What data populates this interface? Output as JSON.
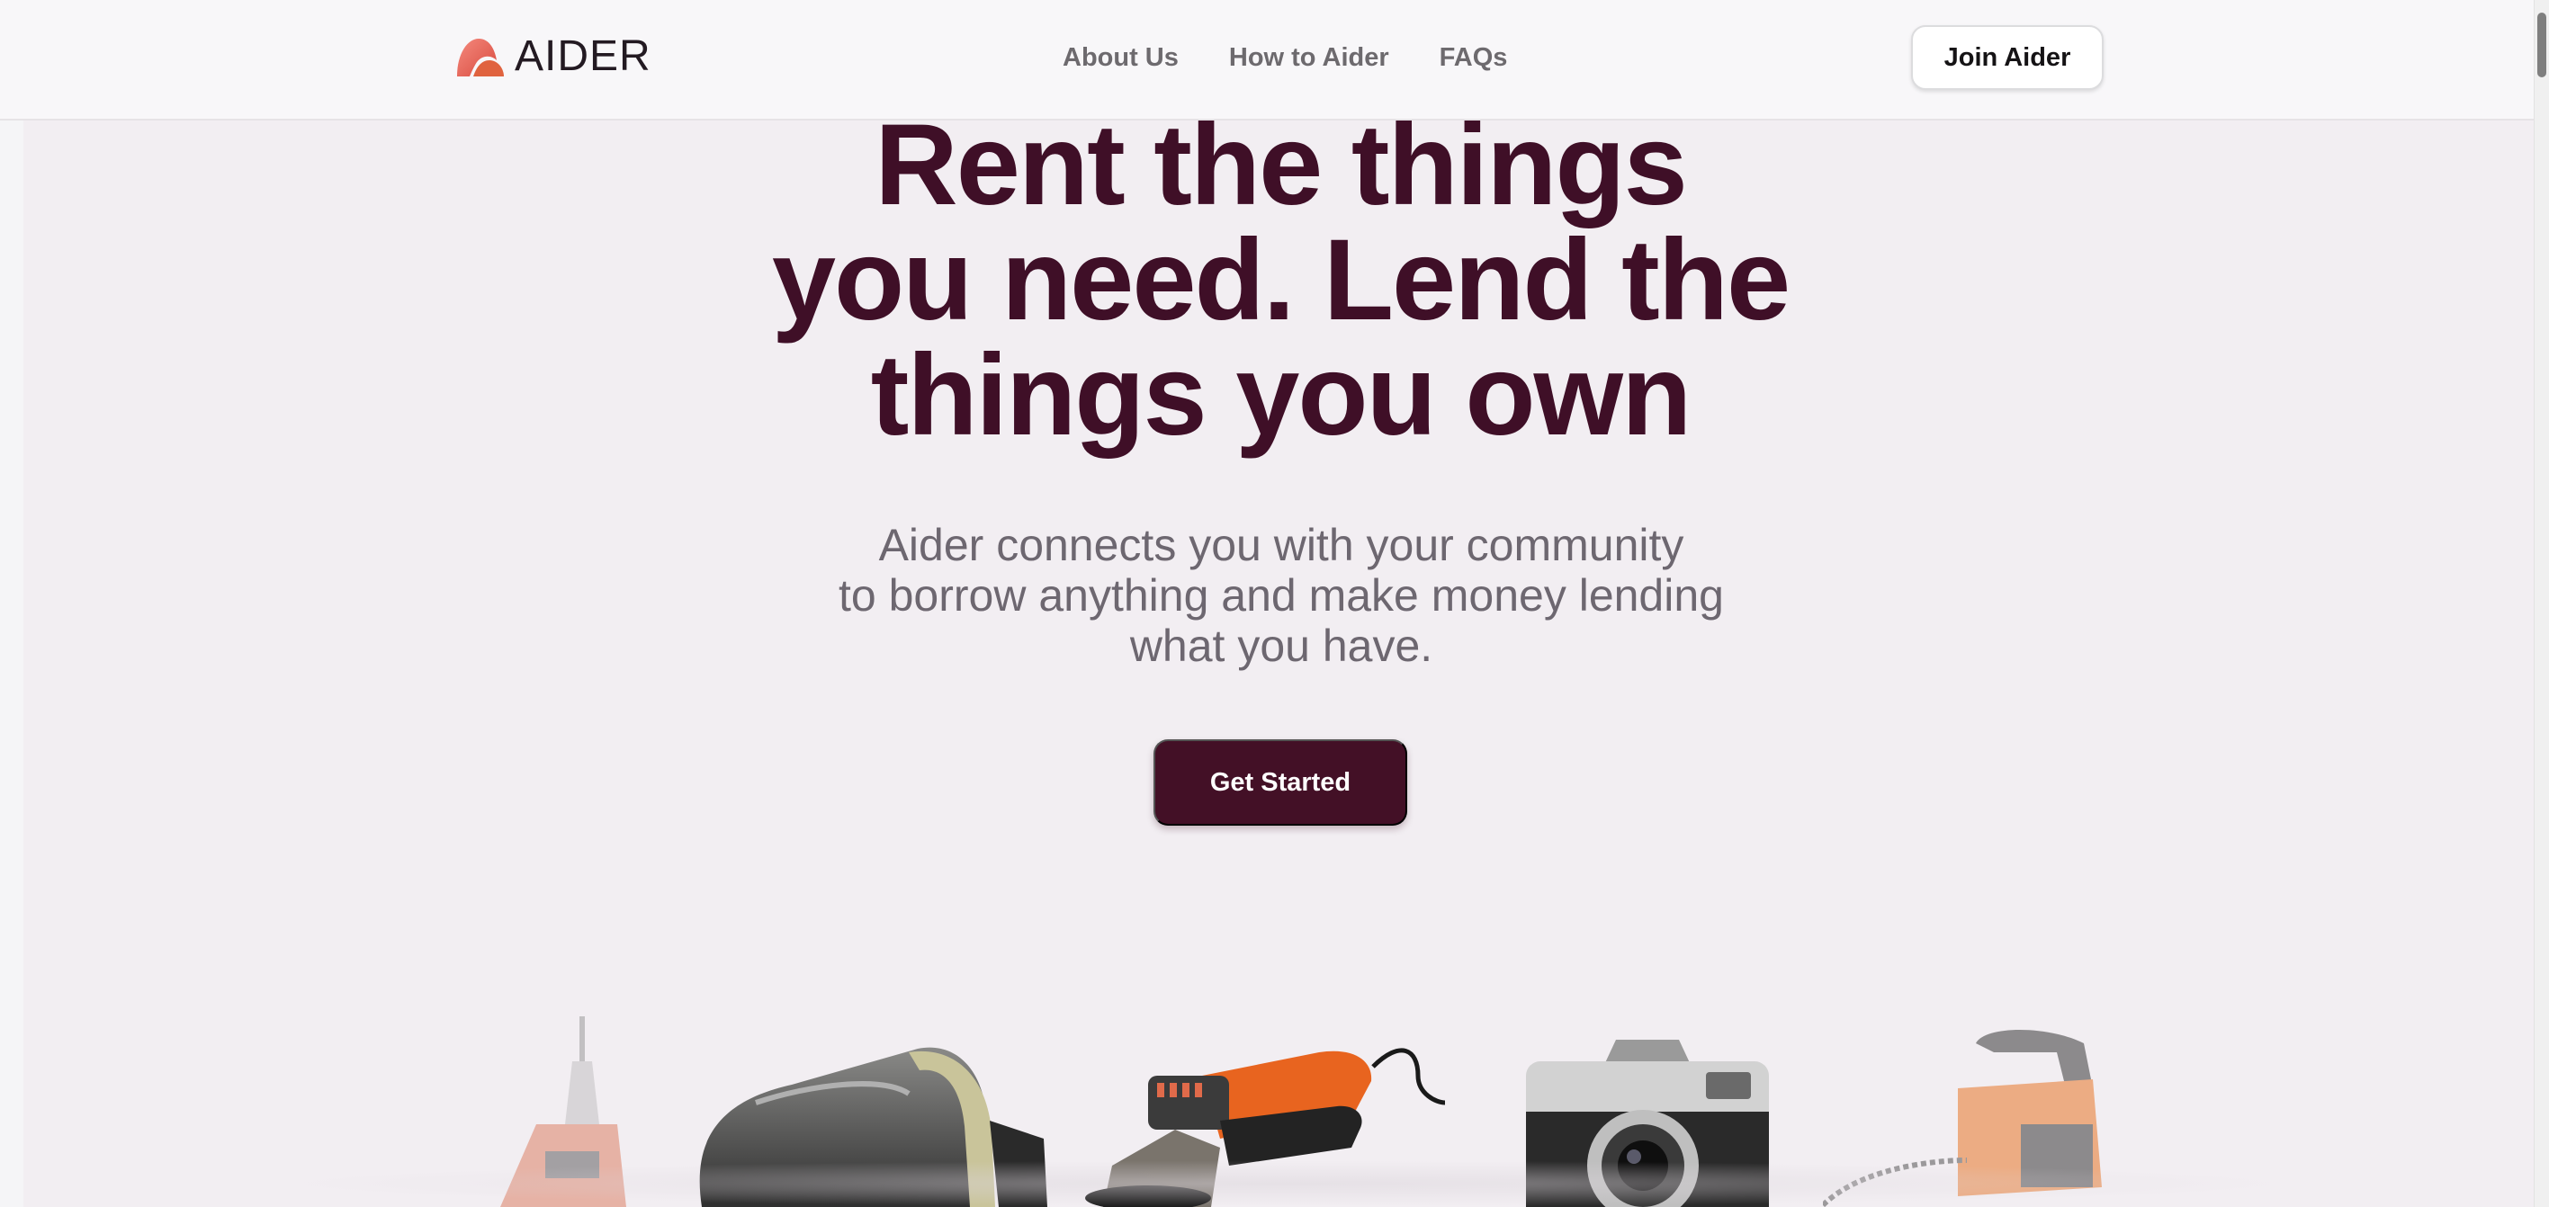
{
  "nav": {
    "logo_text": "AIDER",
    "links": [
      {
        "label": "About Us"
      },
      {
        "label": "How to Aider"
      },
      {
        "label": "FAQs"
      }
    ],
    "join_label": "Join Aider"
  },
  "hero": {
    "title_lines": [
      "Rent the things",
      "you need. Lend the",
      "things you own"
    ],
    "subtitle_lines": [
      "Aider connects you with your community",
      "to borrow anything and make money lending",
      "what you have."
    ],
    "cta_label": "Get Started"
  },
  "products": [
    {
      "icon": "drill-icon"
    },
    {
      "icon": "vr-headset-icon"
    },
    {
      "icon": "angle-grinder-icon"
    },
    {
      "icon": "camera-icon"
    },
    {
      "icon": "chainsaw-icon"
    }
  ],
  "colors": {
    "brand": "#431026",
    "title": "#3f0f27",
    "background": "#f2eef2",
    "logo_gradient": [
      "#f0766f",
      "#d9553f"
    ]
  }
}
